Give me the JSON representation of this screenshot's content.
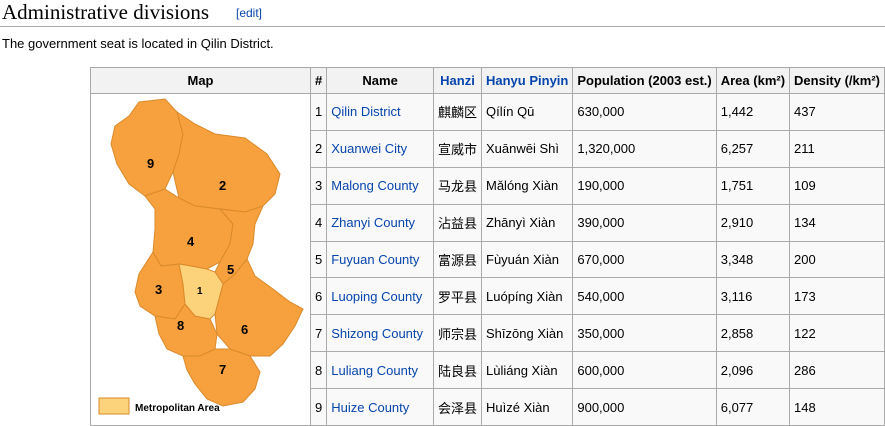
{
  "section": {
    "title": "Administrative divisions",
    "edit_label": "[edit]",
    "intro": "The government seat is located in Qilin District."
  },
  "table": {
    "headers": {
      "map": "Map",
      "num": "#",
      "name": "Name",
      "hanzi": "Hanzi",
      "pinyin": "Hanyu Pinyin",
      "population": "Population (2003 est.)",
      "area": "Area (km²)",
      "density": "Density (/km²)"
    },
    "rows": [
      {
        "num": "1",
        "name": "Qilin District",
        "hanzi": "麒麟区",
        "pinyin": "Qílín Qū",
        "population": "630,000",
        "area": "1,442",
        "density": "437"
      },
      {
        "num": "2",
        "name": "Xuanwei City",
        "hanzi": "宣威市",
        "pinyin": "Xuānwēi Shì",
        "population": "1,320,000",
        "area": "6,257",
        "density": "211"
      },
      {
        "num": "3",
        "name": "Malong County",
        "hanzi": "马龙县",
        "pinyin": "Mǎlóng Xiàn",
        "population": "190,000",
        "area": "1,751",
        "density": "109"
      },
      {
        "num": "4",
        "name": "Zhanyi County",
        "hanzi": "沾益县",
        "pinyin": "Zhānyì Xiàn",
        "population": "390,000",
        "area": "2,910",
        "density": "134"
      },
      {
        "num": "5",
        "name": "Fuyuan County",
        "hanzi": "富源县",
        "pinyin": "Fùyuán Xiàn",
        "population": "670,000",
        "area": "3,348",
        "density": "200"
      },
      {
        "num": "6",
        "name": "Luoping County",
        "hanzi": "罗平县",
        "pinyin": "Luópíng Xiàn",
        "population": "540,000",
        "area": "3,116",
        "density": "173"
      },
      {
        "num": "7",
        "name": "Shizong County",
        "hanzi": "师宗县",
        "pinyin": "Shīzōng Xiàn",
        "population": "350,000",
        "area": "2,858",
        "density": "122"
      },
      {
        "num": "8",
        "name": "Luliang County",
        "hanzi": "陆良县",
        "pinyin": "Lùliáng Xiàn",
        "population": "600,000",
        "area": "2,096",
        "density": "286"
      },
      {
        "num": "9",
        "name": "Huize County",
        "hanzi": "会泽县",
        "pinyin": "Huìzé Xiàn",
        "population": "900,000",
        "area": "6,077",
        "density": "148"
      }
    ]
  },
  "map": {
    "region_labels": [
      "1",
      "2",
      "3",
      "4",
      "5",
      "6",
      "7",
      "8",
      "9"
    ],
    "legend_label": "Metropolitan Area",
    "colors": {
      "county": "#f7a03e",
      "metro": "#fcd27a",
      "border": "#d98a2b"
    }
  }
}
